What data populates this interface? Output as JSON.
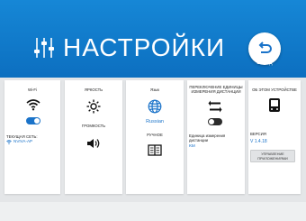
{
  "header": {
    "title": "НАСТРОЙКИ",
    "back_label": "выход"
  },
  "cards": {
    "wifi": {
      "title": "Wi-Fi",
      "enabled": true,
      "current_network_label": "ТЕКУЩАЯ СЕТЬ:",
      "network_name": "NVIVA-AP"
    },
    "brightness": {
      "title": "ЯРКОСТЬ",
      "volume_label": "ГРОМКОСТЬ"
    },
    "language": {
      "title": "Язык",
      "value": "Russian",
      "manual_label": "РУЧНОЕ"
    },
    "distance": {
      "title": "ПЕРЕКЛЮЧЕНИЕ ЕДИНИЦЫ ИЗМЕРЕНИЯ ДИСТАНЦИИ",
      "enabled": false,
      "unit_label": "Единица измерения дистанции",
      "unit_value": "КМ"
    },
    "device": {
      "title": "ОБ ЭТОМ УСТРОЙСТВЕ",
      "version_label": "ВЕРСИЯ",
      "version_value": "V 1.4.18",
      "apps_button": "УПРАВЛЕНИЕ ПРИЛОЖЕНИЯМИ"
    }
  },
  "colors": {
    "header_blue": "#0c6fc0",
    "accent_blue": "#1a73c9",
    "toggle_off": "#2b2b2b"
  },
  "icons": [
    "sliders-icon",
    "back-arrow-icon",
    "wifi-icon",
    "sun-icon",
    "speaker-icon",
    "globe-icon",
    "book-icon",
    "swap-arrows-icon",
    "device-icon"
  ]
}
